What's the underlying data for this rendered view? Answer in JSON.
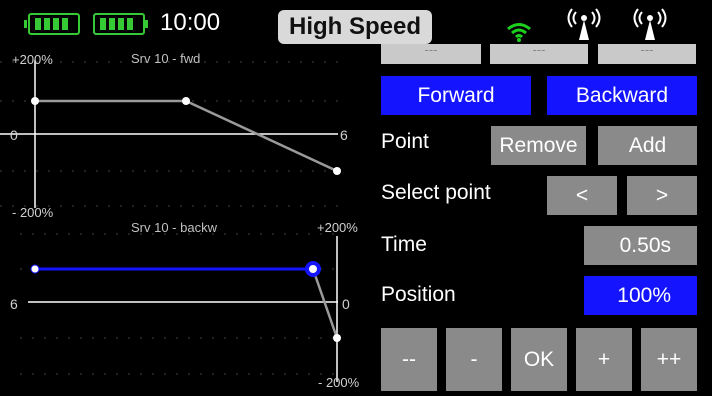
{
  "status": {
    "time": "10:00",
    "mode": "High Speed",
    "antenna_labels": [
      "---",
      "---",
      "---"
    ],
    "colors": {
      "battery": "#35c935",
      "wifi": "#1ed01e"
    }
  },
  "graph_fwd": {
    "title": "Srv 10 - fwd",
    "y_top": "+200%",
    "y_mid": "0",
    "y_bottom": "- 200%",
    "x_end": "6"
  },
  "graph_back": {
    "title": "Srv 10 - backw",
    "y_top": "+200%",
    "y_mid": "0",
    "y_bottom": "- 200%",
    "x_start": "6"
  },
  "controls": {
    "forward": "Forward",
    "backward": "Backward",
    "point_label": "Point",
    "remove": "Remove",
    "add": "Add",
    "select_point_label": "Select point",
    "prev": "<",
    "next": ">",
    "time_label": "Time",
    "time_value": "0.50s",
    "position_label": "Position",
    "position_value": "100%",
    "step_big_down": "--",
    "step_down": "-",
    "ok": "OK",
    "step_up": "+",
    "step_big_up": "++"
  },
  "colors": {
    "accent_blue": "#1414ff",
    "button_gray": "#8a8a8a",
    "curve_gray": "#9a9a9a"
  }
}
